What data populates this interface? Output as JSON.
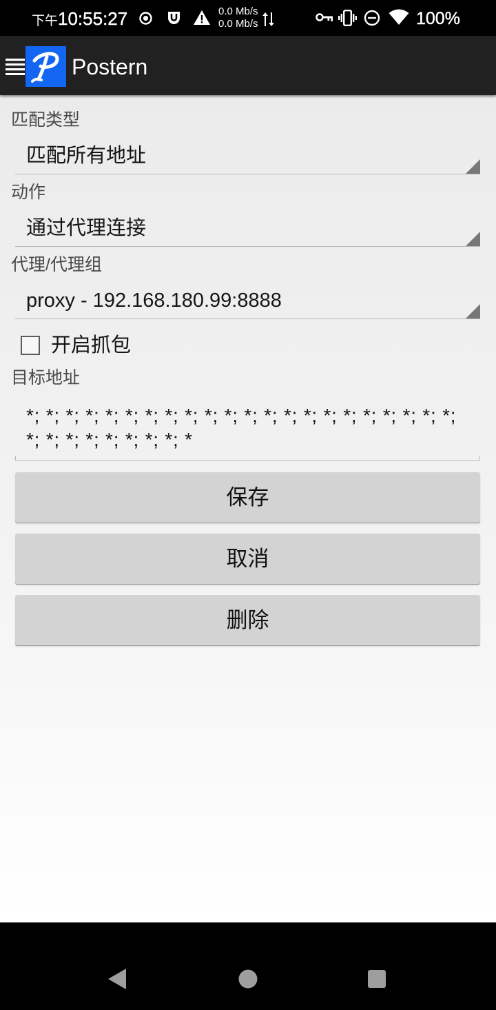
{
  "status_bar": {
    "period": "下午",
    "time": "10:55:27",
    "net_speed_up": "0.0 Mb/s",
    "net_speed_down": "0.0 Mb/s",
    "battery": "100%",
    "icons": [
      "target-icon",
      "shield-icon",
      "warning-icon",
      "data-transfer-icon",
      "vpn-key-icon",
      "vibrate-icon",
      "do-not-disturb-icon",
      "wifi-icon"
    ]
  },
  "action_bar": {
    "title": "Postern",
    "logo_text": "P",
    "icons": [
      "menu-icon",
      "app-logo"
    ]
  },
  "form": {
    "match_type": {
      "label": "匹配类型",
      "value": "匹配所有地址"
    },
    "action": {
      "label": "动作",
      "value": "通过代理连接"
    },
    "proxy": {
      "label": "代理/代理组",
      "value": "proxy - 192.168.180.99:8888"
    },
    "capture": {
      "label": "开启抓包",
      "checked": false
    },
    "target": {
      "label": "目标地址",
      "value": "*; *; *; *; *; *; *; *; *; *; *; *; *; *; *; *; *; *; *; *; *; *; *; *; *; *; *; *; *; *; *"
    }
  },
  "buttons": {
    "save": "保存",
    "cancel": "取消",
    "delete": "删除"
  },
  "nav_bar": {
    "icons": [
      "back-icon",
      "home-icon",
      "recents-icon"
    ]
  },
  "colors": {
    "status_bar_bg": "#000000",
    "action_bar_bg": "#212121",
    "logo_bg": "#1266f1",
    "content_bg_top": "#ebebeb",
    "content_bg_bottom": "#ffffff",
    "button_bg": "#d3d3d3",
    "nav_bar_bg": "#000000"
  }
}
